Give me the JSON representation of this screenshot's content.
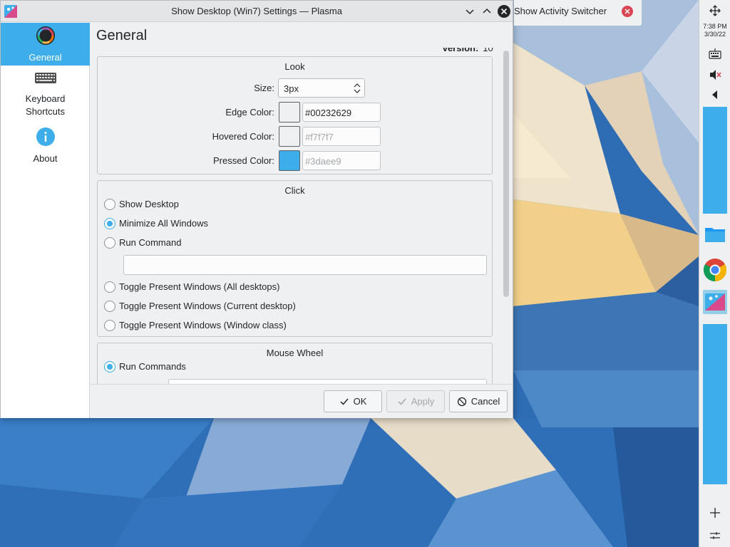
{
  "window": {
    "title": "Show Desktop (Win7) Settings — Plasma",
    "controls": [
      "minimize",
      "maximize",
      "close"
    ]
  },
  "sidebar": {
    "items": [
      {
        "label": "General",
        "icon": "color-wheel-icon",
        "active": true
      },
      {
        "label": "Keyboard\nShortcuts",
        "icon": "keyboard-icon",
        "active": false
      },
      {
        "label": "About",
        "icon": "info-icon",
        "active": false
      }
    ]
  },
  "page": {
    "title": "General",
    "version_label": "Version:",
    "version_value": "10"
  },
  "look": {
    "title": "Look",
    "size_label": "Size:",
    "size_value": "3px",
    "edge_label": "Edge Color:",
    "edge_value": "#00232629",
    "edge_swatch": "#eff0f1",
    "hovered_label": "Hovered Color:",
    "hovered_placeholder": "#f7f7f7",
    "hovered_swatch": "#eff0f1",
    "pressed_label": "Pressed Color:",
    "pressed_placeholder": "#3daee9",
    "pressed_swatch": "#3daee9"
  },
  "click": {
    "title": "Click",
    "options": [
      {
        "label": "Show Desktop",
        "checked": false
      },
      {
        "label": "Minimize All Windows",
        "checked": true
      },
      {
        "label": "Run Command",
        "checked": false
      },
      {
        "label": "Toggle Present Windows (All desktops)",
        "checked": false
      },
      {
        "label": "Toggle Present Windows (Current desktop)",
        "checked": false
      },
      {
        "label": "Toggle Present Windows (Window class)",
        "checked": false
      }
    ],
    "command_value": ""
  },
  "mouse_wheel": {
    "title": "Mouse Wheel",
    "options": [
      {
        "label": "Run Commands",
        "checked": true
      }
    ]
  },
  "buttons": {
    "ok": "OK",
    "apply": "Apply",
    "cancel": "Cancel"
  },
  "activity_switcher": {
    "label": "Show Activity Switcher"
  },
  "panel": {
    "time": "7:38 PM",
    "date": "3/30/22",
    "tray_icons": [
      "move-icon",
      "keyboard-icon",
      "volume-muted-icon",
      "arrow-left-icon"
    ],
    "tasks": [
      "file-manager-icon",
      "chrome-icon",
      "plasma-settings-icon"
    ]
  },
  "colors": {
    "accent": "#3daee9",
    "window_bg": "#eff0f1",
    "close_red": "#da4453"
  }
}
